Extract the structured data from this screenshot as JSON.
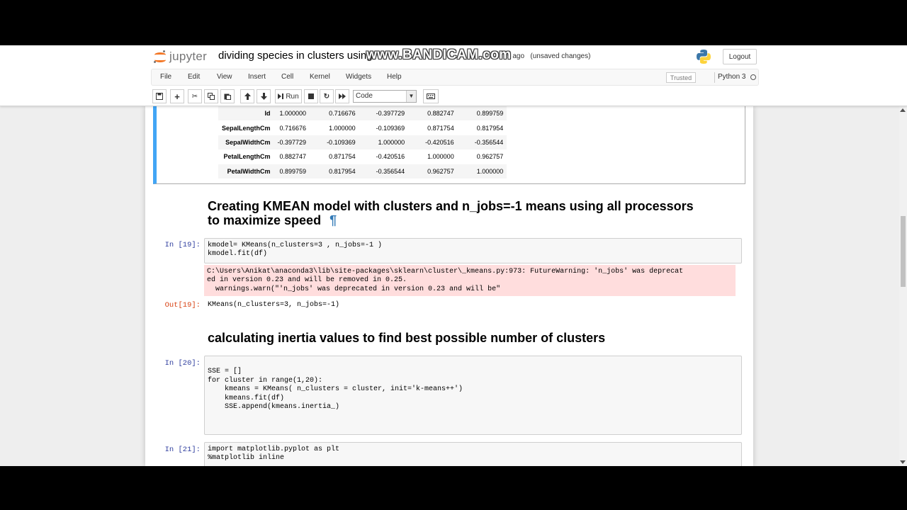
{
  "header": {
    "logo_text": "jupyter",
    "notebook_title": "dividing species in clusters using",
    "save_status": "es ago",
    "unsaved": "(unsaved changes)",
    "watermark": "www.BANDICAM.com",
    "logout": "Logout"
  },
  "menu": {
    "items": [
      "File",
      "Edit",
      "View",
      "Insert",
      "Cell",
      "Kernel",
      "Widgets",
      "Help"
    ],
    "trusted": "Trusted",
    "kernel": "Python 3"
  },
  "toolbar": {
    "run_label": "Run",
    "cell_type": "Code"
  },
  "correlation_table": {
    "rows": [
      {
        "label": "Id",
        "values": [
          "1.000000",
          "0.716676",
          "-0.397729",
          "0.882747",
          "0.899759"
        ]
      },
      {
        "label": "SepalLengthCm",
        "values": [
          "0.716676",
          "1.000000",
          "-0.109369",
          "0.871754",
          "0.817954"
        ]
      },
      {
        "label": "SepalWidthCm",
        "values": [
          "-0.397729",
          "-0.109369",
          "1.000000",
          "-0.420516",
          "-0.356544"
        ]
      },
      {
        "label": "PetalLengthCm",
        "values": [
          "0.882747",
          "0.871754",
          "-0.420516",
          "1.000000",
          "0.962757"
        ]
      },
      {
        "label": "PetalWidthCm",
        "values": [
          "0.899759",
          "0.817954",
          "-0.356544",
          "0.962757",
          "1.000000"
        ]
      }
    ]
  },
  "cells": {
    "md1_line1": "Creating KMEAN model with clusters and n_jobs=-1 means using all processors",
    "md1_line2": "to maximize speed",
    "pilcrow": "¶",
    "in19_prompt": "In [19]:",
    "in19_line1": "kmodel= KMeans(n_clusters=3 , n_jobs=-1 )",
    "in19_line2": "kmodel.fit(df)",
    "stderr_line1": "C:\\Users\\Anikat\\anaconda3\\lib\\site-packages\\sklearn\\cluster\\_kmeans.py:973: FutureWarning: 'n_jobs' was deprecat",
    "stderr_line2": "ed in version 0.23 and will be removed in 0.25.",
    "stderr_line3": "  warnings.warn(\"'n_jobs' was deprecated in version 0.23 and will be\"",
    "out19_prompt": "Out[19]:",
    "out19_text": "KMeans(n_clusters=3, n_jobs=-1)",
    "md2": "calculating inertia values to find best possible number of clusters",
    "in20_prompt": "In [20]:",
    "in20_lines": [
      "",
      "SSE = []",
      "for cluster in range(1,20):",
      "    kmeans = KMeans( n_clusters = cluster, init='k-means++')",
      "    kmeans.fit(df)",
      "    SSE.append(kmeans.inertia_)"
    ],
    "in21_prompt": "In [21]:",
    "in21_line1": "import matplotlib.pyplot as plt",
    "in21_line2": "%matplotlib inline"
  }
}
